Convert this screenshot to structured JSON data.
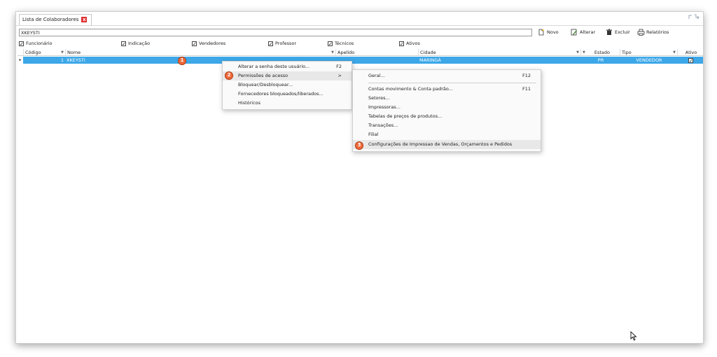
{
  "tab": {
    "title": "Lista de Colaboradores",
    "close": "x"
  },
  "search": {
    "value": "XKEYSTI"
  },
  "toolbar": {
    "novo": "Novo",
    "alterar": "Alterar",
    "excluir": "Excluir",
    "relatorios": "Relatórios"
  },
  "filters": [
    {
      "label": "Funcionário",
      "checked": true
    },
    {
      "label": "Indicação",
      "checked": true
    },
    {
      "label": "Vendedores",
      "checked": true
    },
    {
      "label": "Professor",
      "checked": true
    },
    {
      "label": "Técnicos",
      "checked": true
    },
    {
      "label": "Ativos",
      "checked": true
    }
  ],
  "check_glyph": "✓",
  "columns": [
    "Código",
    "Nome",
    "Apelido",
    "Cidade",
    "Estado",
    "Tipo",
    "Ativo"
  ],
  "row": {
    "codigo": "1",
    "nome": "XKEYSTI",
    "apelido": "",
    "cidade": "MARINGÁ",
    "estado": "PR",
    "tipo": "VENDEDOR",
    "ativo": "✓",
    "indicator": "▸"
  },
  "badges": [
    "1",
    "2",
    "3"
  ],
  "context_menu": [
    {
      "label": "Alterar a senha deste usuário...",
      "shortcut": "F2"
    },
    {
      "label": "Permissões de acesso",
      "shortcut": ">"
    },
    {
      "label": "Bloquear/Desbloquear...",
      "shortcut": ""
    },
    {
      "label": "Fornecedores bloqueados/liberados...",
      "shortcut": ""
    },
    {
      "label": "Históricos",
      "shortcut": ""
    }
  ],
  "submenu": [
    {
      "label": "Geral...",
      "shortcut": "F12"
    },
    {
      "label": "Contas movimento & Conta padrão...",
      "shortcut": "F11"
    },
    {
      "label": "Setores...",
      "shortcut": ""
    },
    {
      "label": "Impressoras...",
      "shortcut": ""
    },
    {
      "label": "Tabelas de preços de produtos...",
      "shortcut": ""
    },
    {
      "label": "Transações...",
      "shortcut": ""
    },
    {
      "label": "Filial",
      "shortcut": ""
    },
    {
      "label": "Configurações de Impressao de Vendas, Orçamentos e Pedidos",
      "shortcut": ""
    }
  ],
  "colors": {
    "selection": "#3da7e8",
    "badge": "#f06a3a",
    "close": "#e03030"
  }
}
